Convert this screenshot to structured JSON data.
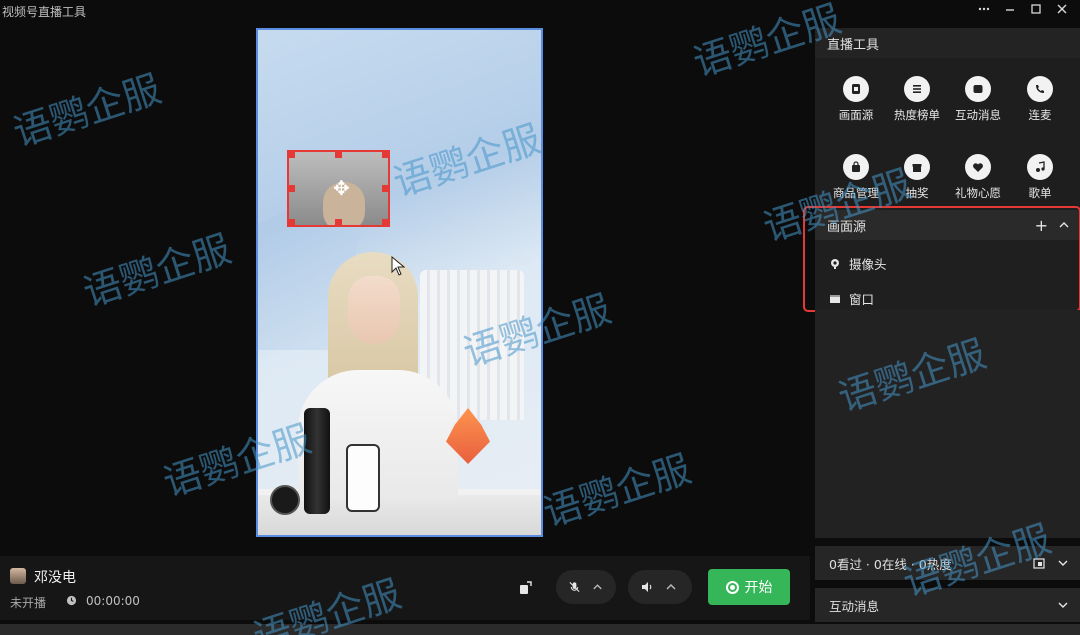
{
  "window": {
    "title": "视频号直播工具",
    "controls": [
      "more-icon",
      "minimize-icon",
      "maximize-icon",
      "close-icon"
    ]
  },
  "tools": {
    "header": "直播工具",
    "items": [
      {
        "label": "画面源",
        "icon": "source-icon"
      },
      {
        "label": "热度榜单",
        "icon": "list-icon"
      },
      {
        "label": "互动消息",
        "icon": "message-icon"
      },
      {
        "label": "连麦",
        "icon": "phone-icon"
      },
      {
        "label": "商品管理",
        "icon": "bag-icon"
      },
      {
        "label": "抽奖",
        "icon": "gift-icon"
      },
      {
        "label": "礼物心愿",
        "icon": "heart-icon"
      },
      {
        "label": "歌单",
        "icon": "music-icon"
      }
    ]
  },
  "source_panel": {
    "header": "画面源",
    "items": [
      {
        "label": "摄像头",
        "icon": "camera-pin-icon"
      },
      {
        "label": "窗口",
        "icon": "window-icon"
      }
    ]
  },
  "stats": {
    "text": "0看过 · 0在线 · 0热度"
  },
  "messages": {
    "header": "互动消息"
  },
  "host": {
    "name": "邓没电",
    "status": "未开播",
    "timer": "00:00:00"
  },
  "controls": {
    "start_label": "开始"
  },
  "watermark": {
    "text": "语鹦企服"
  },
  "colors": {
    "accent_green": "#34b659",
    "highlight_red": "#e53935",
    "preview_border": "#5b8de0"
  }
}
